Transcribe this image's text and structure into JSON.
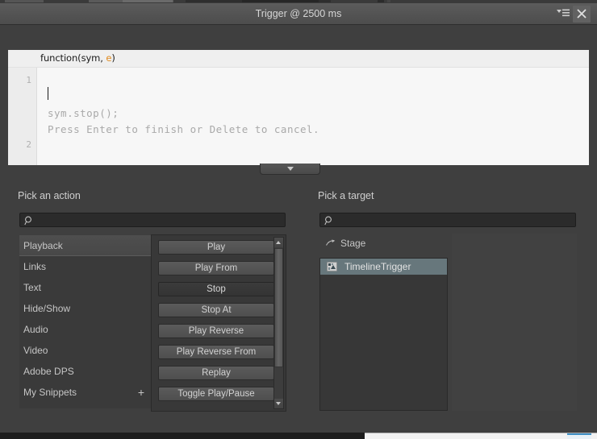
{
  "window": {
    "title": "Trigger @ 2500 ms",
    "menu_icon": "panel-menu-icon",
    "close_icon": "close-icon"
  },
  "editor": {
    "signature_prefix": "function(sym, ",
    "signature_param": "e",
    "signature_suffix": ")",
    "gutter": [
      "1",
      "2"
    ],
    "hint_lines": [
      "sym.stop();",
      "Press Enter to finish or Delete to cancel."
    ],
    "collapse_icon": "chevron-down-icon"
  },
  "action_panel": {
    "heading": "Pick an action",
    "search": {
      "value": "",
      "placeholder": "",
      "icon": "search-icon"
    },
    "categories": [
      {
        "label": "Playback",
        "selected": true,
        "plus": false
      },
      {
        "label": "Links",
        "selected": false,
        "plus": false
      },
      {
        "label": "Text",
        "selected": false,
        "plus": false
      },
      {
        "label": "Hide/Show",
        "selected": false,
        "plus": false
      },
      {
        "label": "Audio",
        "selected": false,
        "plus": false
      },
      {
        "label": "Video",
        "selected": false,
        "plus": false
      },
      {
        "label": "Adobe DPS",
        "selected": false,
        "plus": false
      },
      {
        "label": "My Snippets",
        "selected": false,
        "plus": true,
        "plus_label": "+"
      }
    ],
    "actions": [
      {
        "label": "Play",
        "pressed": false
      },
      {
        "label": "Play From",
        "pressed": false
      },
      {
        "label": "Stop",
        "pressed": true
      },
      {
        "label": "Stop At",
        "pressed": false
      },
      {
        "label": "Play Reverse",
        "pressed": false
      },
      {
        "label": "Play Reverse From",
        "pressed": false
      },
      {
        "label": "Replay",
        "pressed": false
      },
      {
        "label": "Toggle Play/Pause",
        "pressed": false
      }
    ],
    "scrollbar": {
      "up_icon": "scroll-up-arrow-icon",
      "down_icon": "scroll-down-arrow-icon"
    }
  },
  "target_panel": {
    "heading": "Pick a target",
    "search": {
      "value": "",
      "placeholder": "",
      "icon": "search-icon"
    },
    "stage": {
      "label": "Stage",
      "icon": "stage-arrow-icon"
    },
    "items": [
      {
        "label": "TimelineTrigger",
        "icon": "symbol-icon",
        "selected": true
      }
    ]
  },
  "colors": {
    "window_bg": "#3f3f3f",
    "titlebar": "#555555",
    "editor_bg": "#f7f7f7",
    "accent_param": "#e08a1e",
    "selection": "#67777c"
  }
}
